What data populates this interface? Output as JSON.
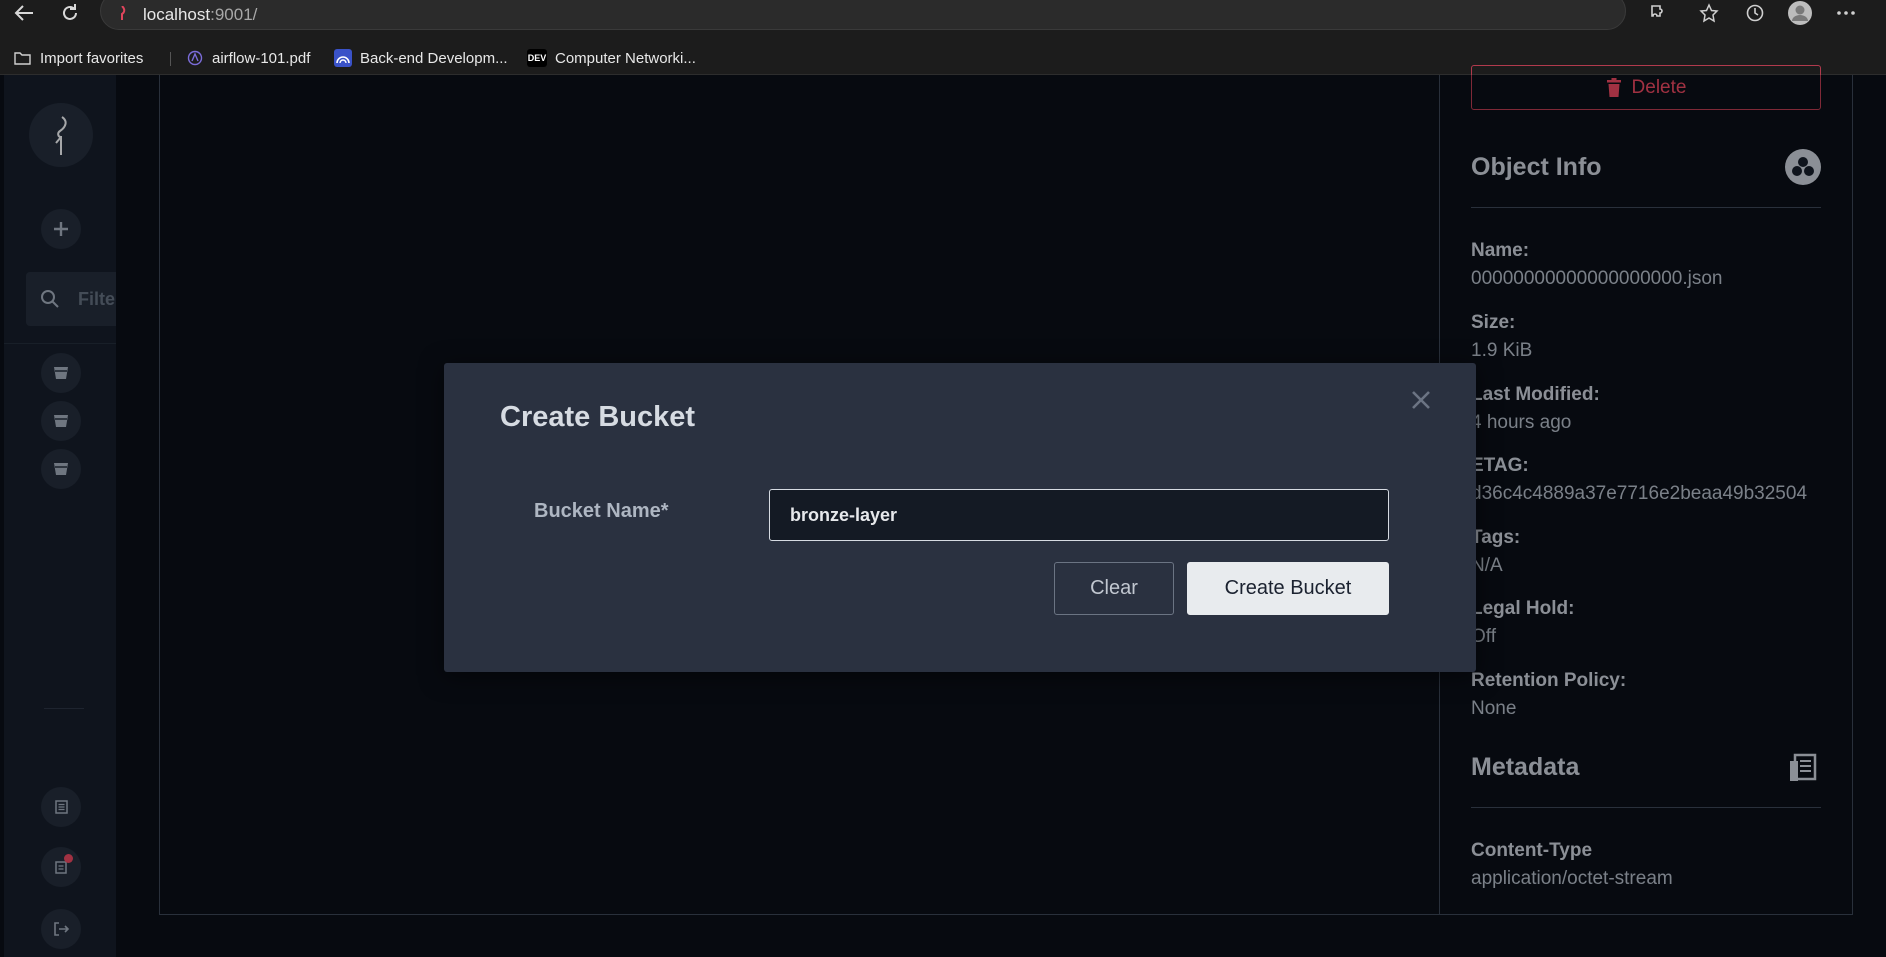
{
  "browser": {
    "address_host": "localhost",
    "address_rest": ":9001/",
    "bookmarks": [
      {
        "label": "Import favorites",
        "icon": "folder-import-icon"
      },
      {
        "label": "airflow-101.pdf",
        "icon": "pdf-icon"
      },
      {
        "label": "Back-end Developm...",
        "icon": "site-icon"
      },
      {
        "label": "Computer Networki...",
        "icon": "dev-icon",
        "badge": "DEV"
      }
    ]
  },
  "sidebar": {
    "filter_placeholder": "Filter"
  },
  "object_info": {
    "delete_label": "Delete",
    "title": "Object Info",
    "fields": [
      {
        "label": "Name:",
        "value": "00000000000000000000.json"
      },
      {
        "label": "Size:",
        "value": "1.9 KiB"
      },
      {
        "label": "Last Modified:",
        "value": "4 hours ago"
      },
      {
        "label": "ETAG:",
        "value": "d36c4c4889a37e7716e2beaa49b32504"
      },
      {
        "label": "Tags:",
        "value": "N/A"
      },
      {
        "label": "Legal Hold:",
        "value": "Off"
      },
      {
        "label": "Retention Policy:",
        "value": "None"
      }
    ],
    "metadata_title": "Metadata",
    "metadata_fields": [
      {
        "label": "Content-Type",
        "value": "application/octet-stream"
      }
    ]
  },
  "modal": {
    "title": "Create Bucket",
    "field_label": "Bucket Name*",
    "field_value": "bronze-layer",
    "clear_label": "Clear",
    "create_label": "Create Bucket"
  },
  "colors": {
    "background": "#0b0f17",
    "sidebar": "#161d29",
    "modal": "#2a3140",
    "danger": "#e0455c"
  }
}
